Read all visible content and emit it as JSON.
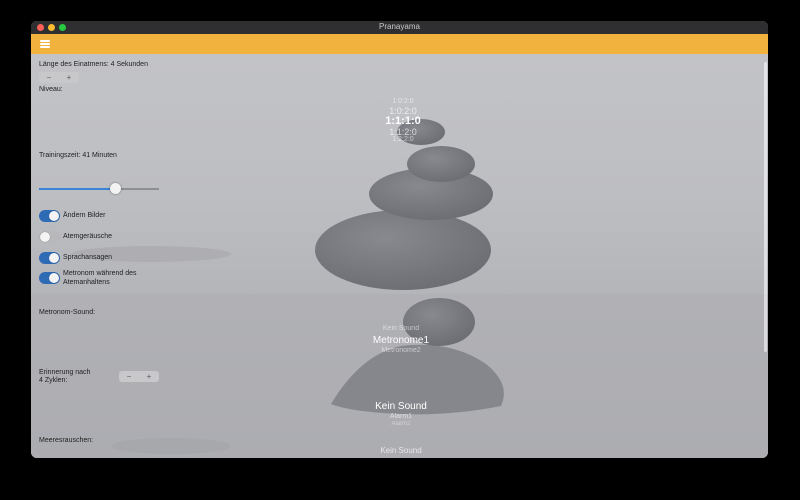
{
  "window": {
    "title": "Pranayama"
  },
  "inhale": {
    "label": "Länge des Einatmens: 4 Sekunden",
    "minus": "−",
    "plus": "+"
  },
  "level": {
    "label": "Niveau:",
    "options": [
      "1:0:2:0",
      "1:0:2:0",
      "1:1:1:0",
      "1:1:2:0",
      "1:2:2:0"
    ],
    "selected": "1:1:1:0"
  },
  "training": {
    "label": "Trainingszeit: 41 Minuten",
    "slider_fraction": 0.64
  },
  "toggles": [
    {
      "label": "Ändern Bilder",
      "on": true
    },
    {
      "label": "Atemgeräusche",
      "on": false
    },
    {
      "label": "Sprachansagen",
      "on": true
    },
    {
      "label_line1": "Metronom während des",
      "label_line2": "Atemanhaltens",
      "on": true
    }
  ],
  "metronome_sound": {
    "label": "Metronom-Sound:",
    "above": "Kein Sound",
    "selected": "Metronome1",
    "below": "Metronome2"
  },
  "reminder": {
    "label_line1": "Erinnerung nach",
    "label_line2": "4 Zyklen:",
    "minus": "−",
    "plus": "+",
    "selected": "Kein Sound",
    "below1": "Alarm1",
    "below2": "Alarm2"
  },
  "sea_sound": {
    "label": "Meeresrauschen:",
    "selected": "Kein Sound"
  },
  "icons": {
    "menu": "hamburger-menu-icon"
  },
  "colors": {
    "accent": "#f2b23e",
    "toggle_on": "#2f6ab5",
    "slider": "#3b82d8"
  }
}
